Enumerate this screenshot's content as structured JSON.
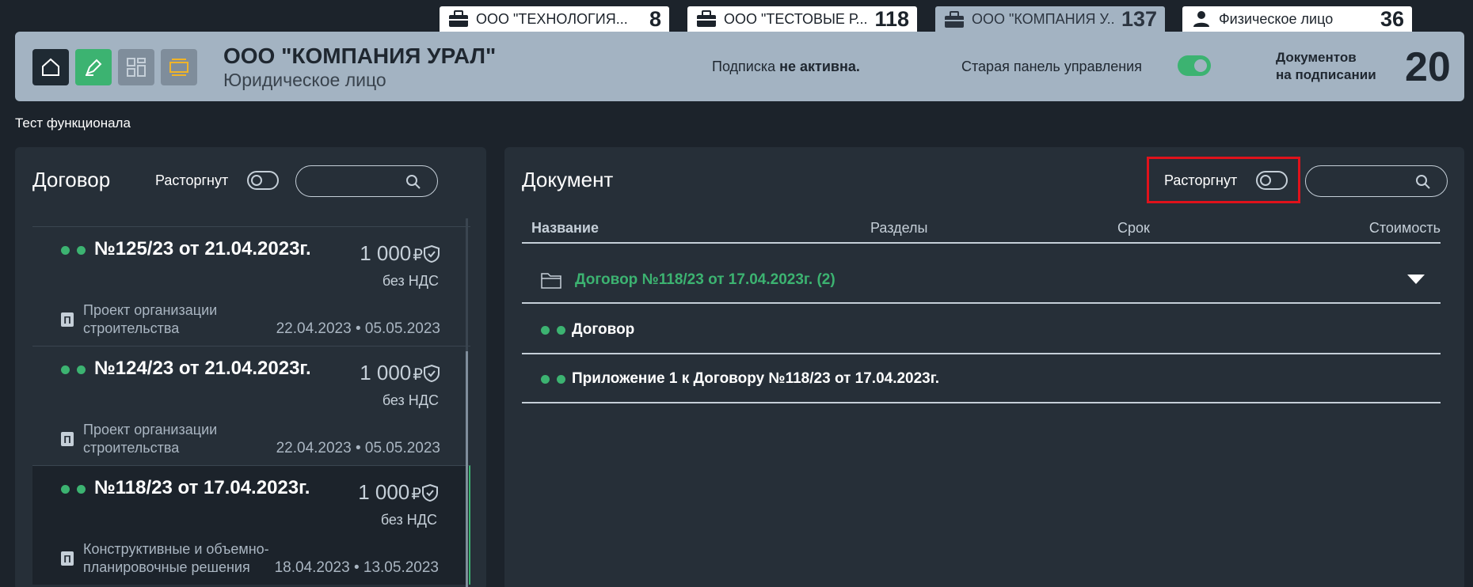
{
  "tabs": [
    {
      "label": "ООО \"ТЕХНОЛОГИЯ...",
      "count": "8",
      "icon": "briefcase-icon"
    },
    {
      "label": "ООО \"ТЕСТОВЫЕ Р...",
      "count": "118",
      "icon": "briefcase-icon"
    },
    {
      "label": "ООО \"КОМПАНИЯ У...",
      "count": "137",
      "icon": "briefcase-icon",
      "active": true
    },
    {
      "label": "Физическое лицо",
      "count": "36",
      "icon": "person-icon"
    }
  ],
  "header": {
    "company_name": "ООО \"КОМПАНИЯ УРАЛ\"",
    "company_type": "Юридическое лицо",
    "subscription_prefix": "Подписка ",
    "subscription_status": "не активна.",
    "old_panel_label": "Старая панель управления",
    "docs_label_line1": "Документов",
    "docs_label_line2": "на подписании",
    "docs_count": "20"
  },
  "test_label": "Тест функционала",
  "left_panel": {
    "title": "Договор",
    "toggle_label": "Расторгнут",
    "search_placeholder": "",
    "contracts": [
      {
        "number": "№125/23 от 21.04.2023г.",
        "amount": "1 000",
        "currency": "₽",
        "vat": "без НДС",
        "badge": "П",
        "desc": "Проект организации строительства",
        "dates": "22.04.2023 • 05.05.2023"
      },
      {
        "number": "№124/23 от 21.04.2023г.",
        "amount": "1 000",
        "currency": "₽",
        "vat": "без НДС",
        "badge": "П",
        "desc": "Проект организации строительства",
        "dates": "22.04.2023 • 05.05.2023"
      },
      {
        "number": "№118/23 от 17.04.2023г.",
        "amount": "1 000",
        "currency": "₽",
        "vat": "без НДС",
        "badge": "П",
        "desc": "Конструктивные и объемно-планировочные решения",
        "dates": "18.04.2023 • 13.05.2023"
      }
    ]
  },
  "right_panel": {
    "title": "Документ",
    "toggle_label": "Расторгнут",
    "search_placeholder": "",
    "columns": {
      "name": "Название",
      "sections": "Разделы",
      "term": "Срок",
      "cost": "Стоимость"
    },
    "folder": {
      "label": "Договор №118/23 от 17.04.2023г. (2)"
    },
    "documents": [
      {
        "label": "Договор"
      },
      {
        "label": "Приложение 1 к Договору №118/23 от 17.04.2023г."
      }
    ]
  },
  "colors": {
    "accent": "#3cb371",
    "header_bg": "#a3b3c2",
    "panel_bg": "#262f38",
    "page_bg": "#1c232b",
    "highlight": "#e0121b"
  }
}
